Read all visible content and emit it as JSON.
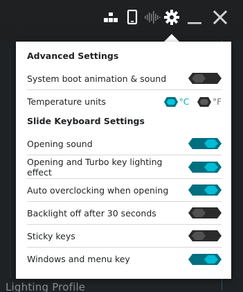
{
  "topbar": {
    "icons": [
      {
        "name": "network-icon"
      },
      {
        "name": "phone-icon"
      },
      {
        "name": "audio-wave-icon"
      },
      {
        "name": "gear-icon"
      },
      {
        "name": "minimize-icon"
      },
      {
        "name": "close-icon"
      }
    ]
  },
  "background": {
    "label": "Lighting Profile"
  },
  "popup": {
    "advanced_header": "Advanced Settings",
    "boot_label": "System boot animation & sound",
    "boot_on": false,
    "temp_label": "Temperature units",
    "temp_c_label": "°C",
    "temp_f_label": "°F",
    "temp_selected": "C",
    "keyboard_header": "Slide Keyboard Settings",
    "settings": [
      {
        "label": "Opening sound",
        "on": true
      },
      {
        "label": "Opening and Turbo key lighting effect",
        "on": true
      },
      {
        "label": "Auto overclocking when opening",
        "on": true
      },
      {
        "label": "Backlight off after 30 seconds",
        "on": false
      },
      {
        "label": "Sticky keys",
        "on": false
      },
      {
        "label": "Windows and menu key",
        "on": true
      }
    ]
  },
  "colors": {
    "accent": "#00bcd4",
    "accent_dark": "#006f80",
    "off_dark": "#2b2b2b",
    "off_light": "#505050"
  }
}
